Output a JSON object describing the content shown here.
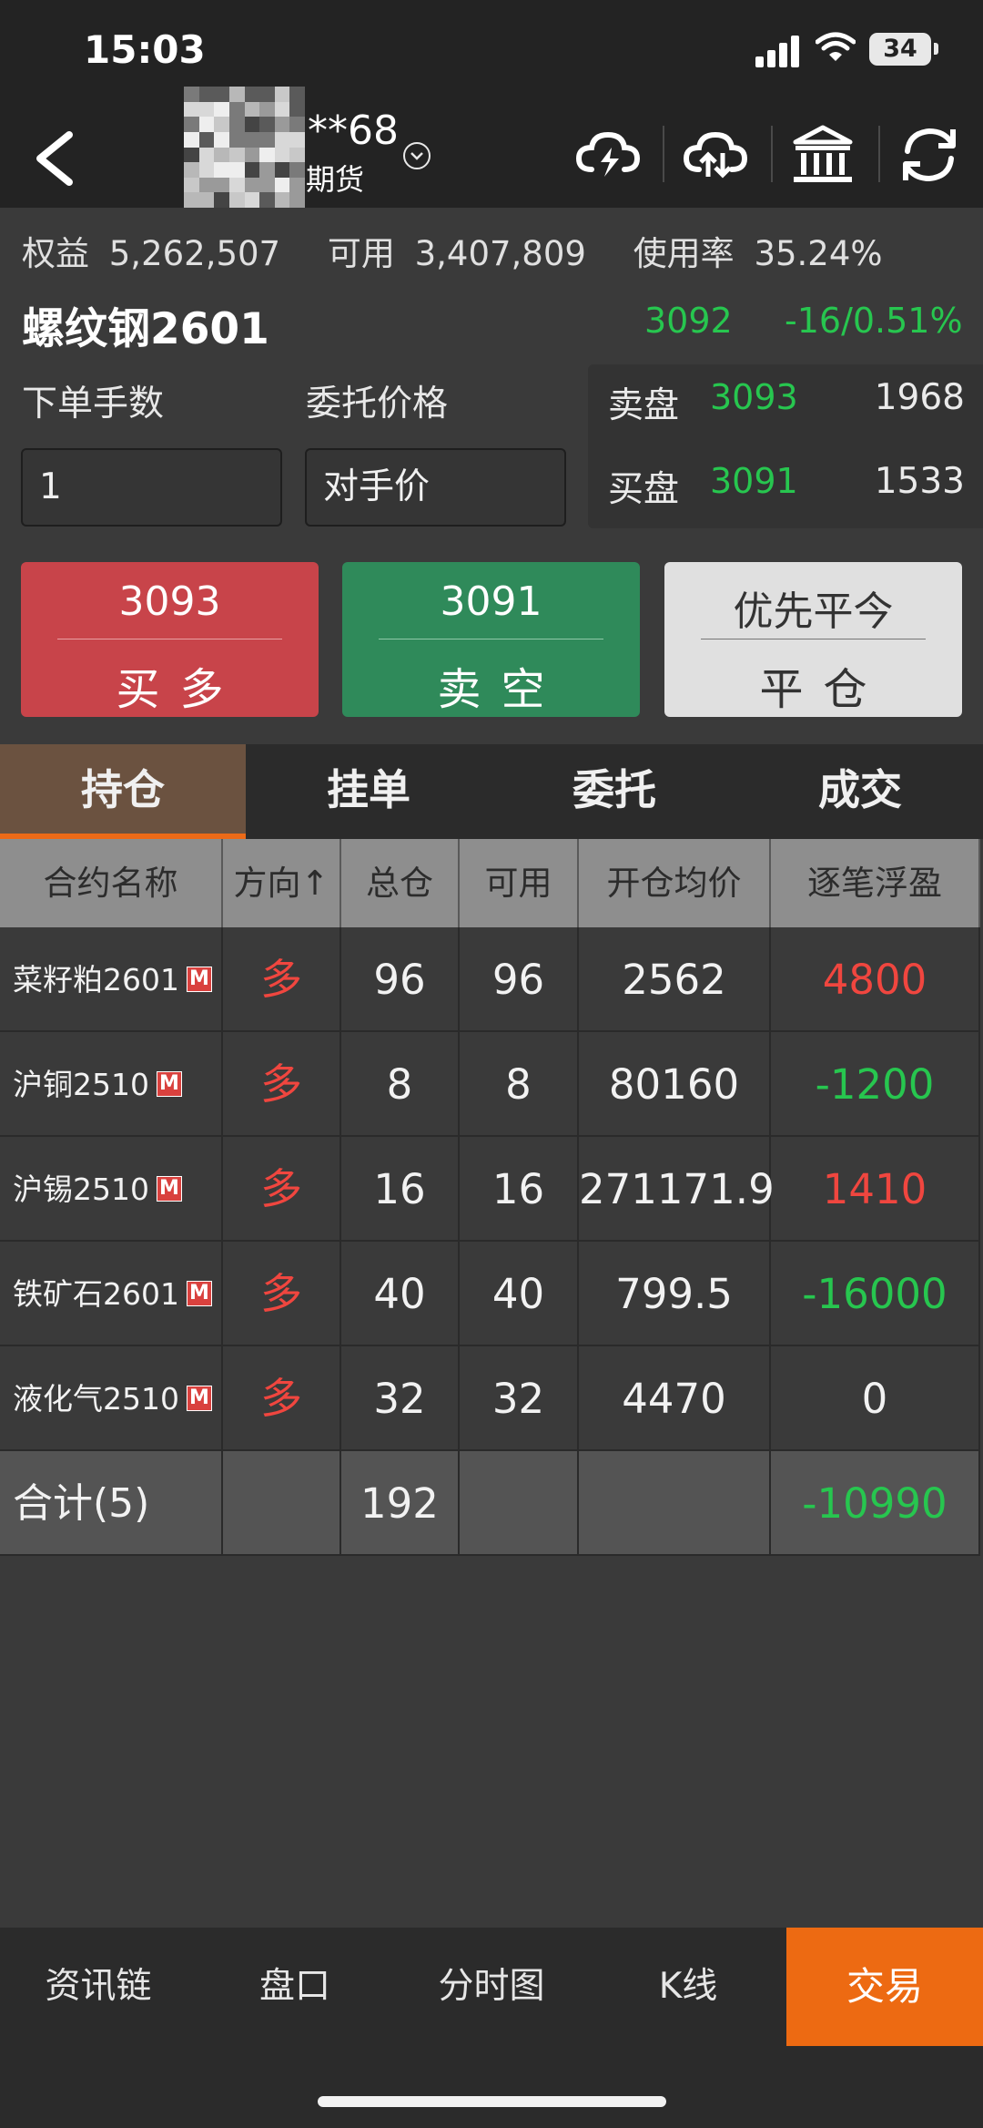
{
  "status": {
    "time": "15:03",
    "battery": "34"
  },
  "account": {
    "name": "**68",
    "type": "期货"
  },
  "summary": {
    "equity_label": "权益",
    "equity_value": "5,262,507",
    "available_label": "可用",
    "available_value": "3,407,809",
    "usage_label": "使用率",
    "usage_value": "35.24%"
  },
  "contract": {
    "name": "螺纹钢2601",
    "last_price": "3092",
    "change": "-16/0.51%"
  },
  "order_form": {
    "qty_label": "下单手数",
    "price_label": "委托价格",
    "qty_value": "1",
    "price_value": "对手价"
  },
  "order_book": {
    "ask": {
      "label": "卖盘",
      "price": "3093",
      "volume": "1968"
    },
    "bid": {
      "label": "买盘",
      "price": "3091",
      "volume": "1533"
    }
  },
  "actions": {
    "buy": {
      "price": "3093",
      "label": "买多"
    },
    "sell": {
      "price": "3091",
      "label": "卖空"
    },
    "close": {
      "mode": "优先平今",
      "label": "平仓"
    }
  },
  "tabs": [
    "持仓",
    "挂单",
    "委托",
    "成交"
  ],
  "positions": {
    "headers": [
      "合约名称",
      "方向↑",
      "总仓",
      "可用",
      "开仓均价",
      "逐笔浮盈"
    ],
    "tag": "M",
    "rows": [
      {
        "name": "菜籽粕2601",
        "dir": "多",
        "total": "96",
        "avail": "96",
        "avg": "2562",
        "pnl": "4800"
      },
      {
        "name": "沪铜2510",
        "dir": "多",
        "total": "8",
        "avail": "8",
        "avg": "80160",
        "pnl": "-1200"
      },
      {
        "name": "沪锡2510",
        "dir": "多",
        "total": "16",
        "avail": "16",
        "avg": "271171.9",
        "pnl": "1410"
      },
      {
        "name": "铁矿石2601",
        "dir": "多",
        "total": "40",
        "avail": "40",
        "avg": "799.5",
        "pnl": "-16000"
      },
      {
        "name": "液化气2510",
        "dir": "多",
        "total": "32",
        "avail": "32",
        "avg": "4470",
        "pnl": "0"
      }
    ],
    "total": {
      "label": "合计(5)",
      "total": "192",
      "pnl": "-10990"
    }
  },
  "bottom_nav": [
    "资讯链",
    "盘口",
    "分时图",
    "K线",
    "交易"
  ],
  "colors": {
    "up": "#f0463f",
    "down": "#27c64f",
    "accent": "#ed6a12"
  }
}
